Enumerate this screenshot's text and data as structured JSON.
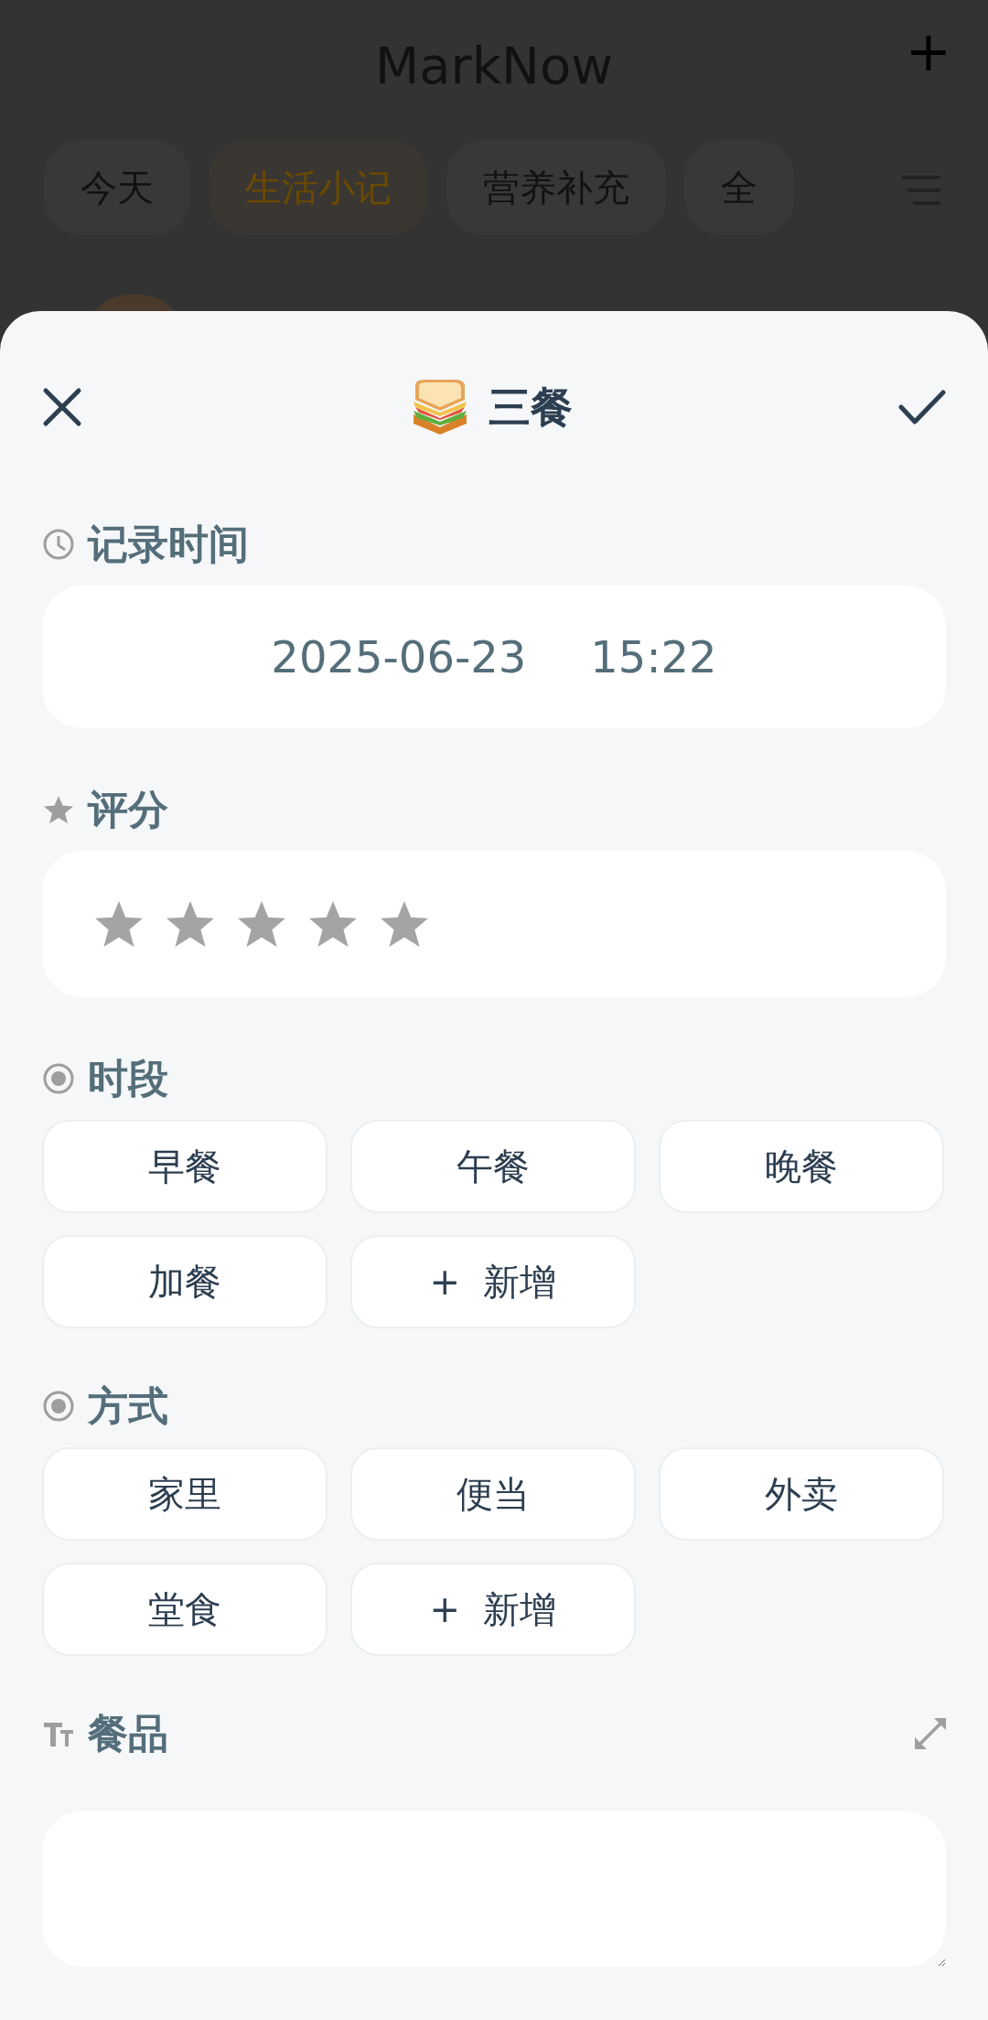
{
  "app_header": {
    "title": "MarkNow",
    "add_symbol": "+"
  },
  "tabs": [
    {
      "label": "今天",
      "selected": false
    },
    {
      "label": "生活小记",
      "selected": true
    },
    {
      "label": "营养补充",
      "selected": false
    },
    {
      "label": "全",
      "selected": false
    }
  ],
  "sheet": {
    "title": "三餐",
    "sections": [
      {
        "kind": "datetime",
        "label": "记录时间",
        "date": "2025-06-23",
        "time": "15:22"
      },
      {
        "kind": "rating",
        "label": "评分",
        "stars": 0
      },
      {
        "kind": "choices",
        "label": "时段",
        "options": [
          {
            "label": "早餐",
            "selected": false
          },
          {
            "label": "午餐",
            "selected": false
          },
          {
            "label": "晚餐",
            "selected": false
          },
          {
            "label": "加餐",
            "selected": false
          },
          {
            "label": "+  新增",
            "selected": false
          }
        ]
      },
      {
        "kind": "choices",
        "label": "方式",
        "options": [
          {
            "label": "家里",
            "selected": false
          },
          {
            "label": "便当",
            "selected": false
          },
          {
            "label": "外卖",
            "selected": false
          },
          {
            "label": "堂食",
            "selected": false
          },
          {
            "label": "+  新增",
            "selected": false
          }
        ]
      },
      {
        "kind": "text",
        "label": "餐品"
      }
    ]
  }
}
